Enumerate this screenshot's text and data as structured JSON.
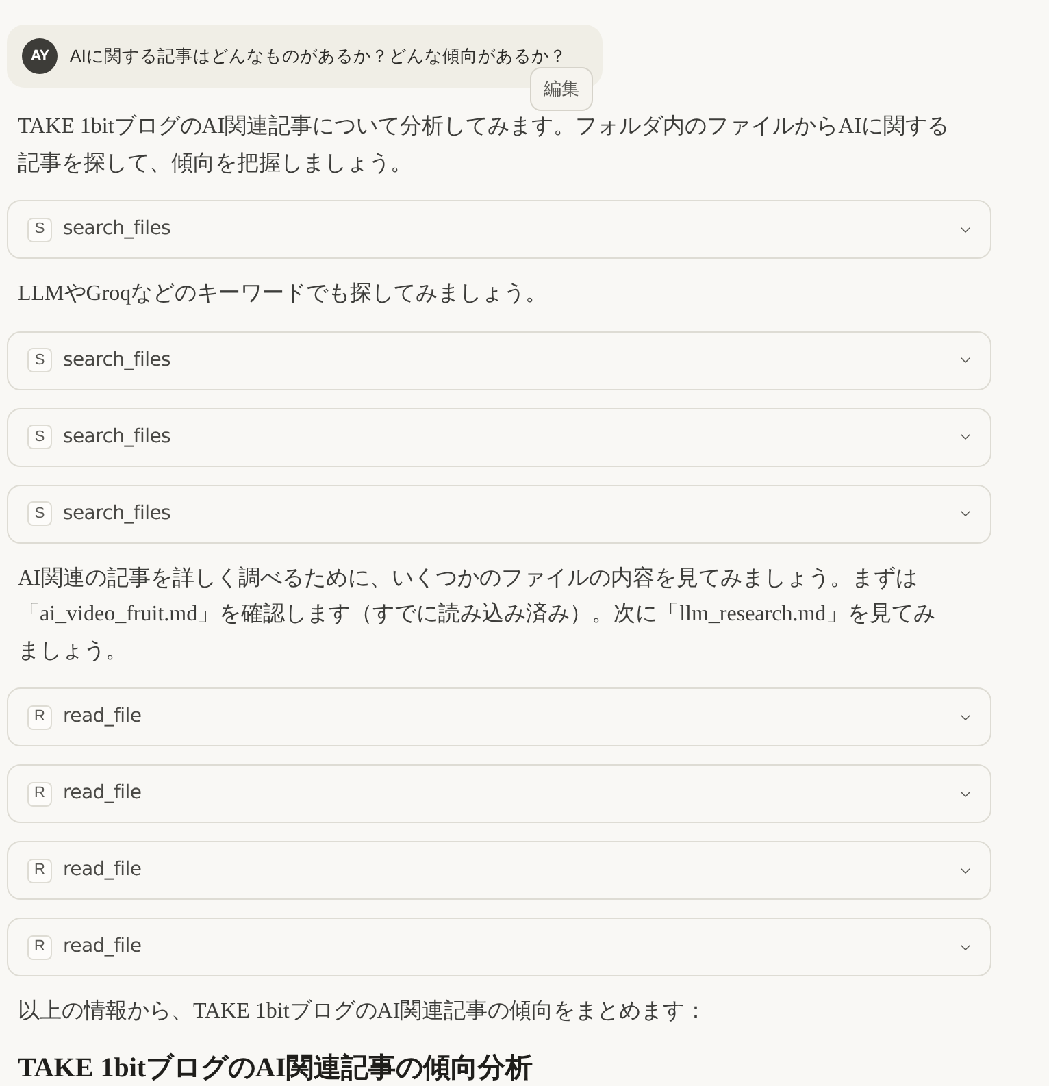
{
  "user_message": {
    "avatar": "AY",
    "text": "AIに関する記事はどんなものがあるか？どんな傾向があるか？",
    "edit_button": "編集"
  },
  "response": [
    {
      "kind": "paragraph",
      "text": "TAKE 1bitブログのAI関連記事について分析してみます。フォルダ内のファイルからAIに関する記事を探して、傾向を把握しましょう。"
    },
    {
      "kind": "tool_call",
      "badge": "S",
      "name": "search_files",
      "expanded": false
    },
    {
      "kind": "paragraph",
      "text": "LLMやGroqなどのキーワードでも探してみましょう。"
    },
    {
      "kind": "tool_call",
      "badge": "S",
      "name": "search_files",
      "expanded": false
    },
    {
      "kind": "tool_call",
      "badge": "S",
      "name": "search_files",
      "expanded": false
    },
    {
      "kind": "tool_call",
      "badge": "S",
      "name": "search_files",
      "expanded": false
    },
    {
      "kind": "paragraph",
      "text": "AI関連の記事を詳しく調べるために、いくつかのファイルの内容を見てみましょう。まずは「ai_video_fruit.md」を確認します（すでに読み込み済み）。次に「llm_research.md」を見てみましょう。"
    },
    {
      "kind": "tool_call",
      "badge": "R",
      "name": "read_file",
      "expanded": false
    },
    {
      "kind": "tool_call",
      "badge": "R",
      "name": "read_file",
      "expanded": false
    },
    {
      "kind": "tool_call",
      "badge": "R",
      "name": "read_file",
      "expanded": false
    },
    {
      "kind": "tool_call",
      "badge": "R",
      "name": "read_file",
      "expanded": false
    },
    {
      "kind": "paragraph",
      "text": "以上の情報から、TAKE 1bitブログのAI関連記事の傾向をまとめます："
    },
    {
      "kind": "heading",
      "text": "TAKE 1bitブログのAI関連記事の傾向分析"
    }
  ]
}
